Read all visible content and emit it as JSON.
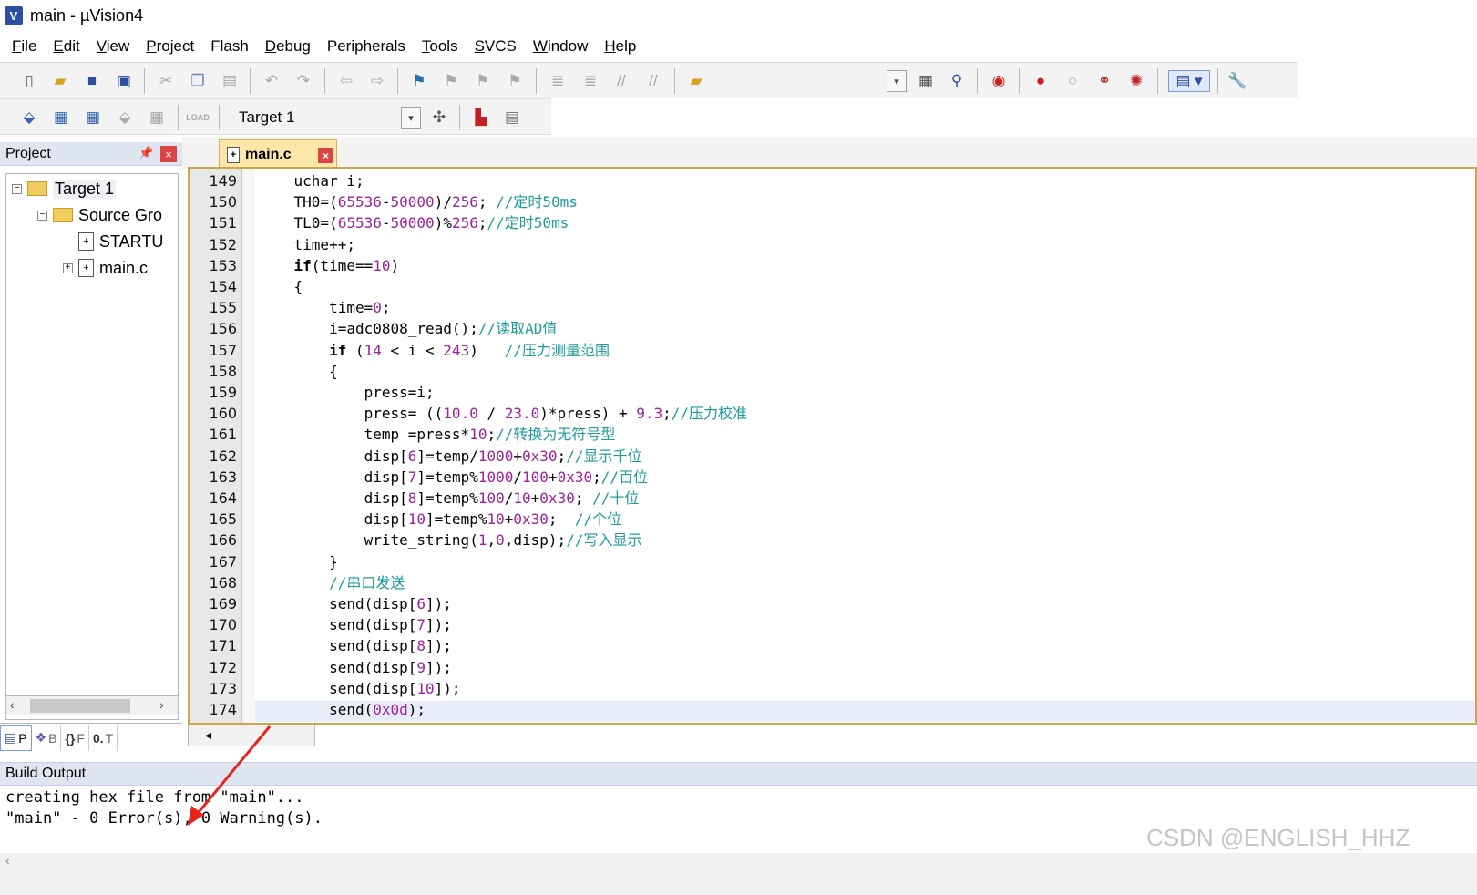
{
  "window": {
    "title": "main  - µVision4",
    "icon_label": "V"
  },
  "menu": [
    {
      "label": "File",
      "u": "F",
      "rest": "ile"
    },
    {
      "label": "Edit",
      "u": "E",
      "rest": "dit"
    },
    {
      "label": "View",
      "u": "V",
      "rest": "iew"
    },
    {
      "label": "Project",
      "u": "P",
      "rest": "roject"
    },
    {
      "label": "Flash",
      "u": "",
      "rest": "Flash"
    },
    {
      "label": "Debug",
      "u": "D",
      "rest": "ebug"
    },
    {
      "label": "Peripherals",
      "u": "",
      "rest": "Peripherals"
    },
    {
      "label": "Tools",
      "u": "T",
      "rest": "ools"
    },
    {
      "label": "SVCS",
      "u": "S",
      "rest": "VCS"
    },
    {
      "label": "Window",
      "u": "W",
      "rest": "indow"
    },
    {
      "label": "Help",
      "u": "H",
      "rest": "elp"
    }
  ],
  "toolbar2": {
    "target": "Target 1",
    "load_label": "LOAD"
  },
  "project": {
    "title": "Project",
    "tree": [
      {
        "label": "Target 1",
        "expander": "−",
        "kind": "target"
      },
      {
        "label": "Source Gro",
        "expander": "−",
        "kind": "folder"
      },
      {
        "label": "STARTU",
        "expander": "",
        "kind": "file"
      },
      {
        "label": "main.c",
        "expander": "+",
        "kind": "file"
      }
    ],
    "tabs": [
      "P",
      "B",
      "F",
      "T"
    ]
  },
  "editor": {
    "tab_label": "main.c",
    "lines": [
      {
        "n": "149",
        "html": "    uchar i;"
      },
      {
        "n": "150",
        "html": "    TH0=(<span class='num'>65536</span>-<span class='num'>50000</span>)/<span class='num'>256</span>; <span class='cm'>//定时50ms</span>"
      },
      {
        "n": "151",
        "html": "    TL0=(<span class='num'>65536</span>-<span class='num'>50000</span>)%<span class='num'>256</span>;<span class='cm'>//定时50ms</span>"
      },
      {
        "n": "152",
        "html": "    time++;"
      },
      {
        "n": "153",
        "html": "    <span class='kw'>if</span>(time==<span class='num'>10</span>)"
      },
      {
        "n": "154",
        "html": "    {"
      },
      {
        "n": "155",
        "html": "        time=<span class='num'>0</span>;"
      },
      {
        "n": "156",
        "html": "        i=adc0808_read();<span class='cm'>//读取AD值</span>"
      },
      {
        "n": "157",
        "html": "        <span class='kw'>if</span> (<span class='num'>14</span> &lt; i &lt; <span class='num'>243</span>)   <span class='cm'>//压力测量范围</span>"
      },
      {
        "n": "158",
        "html": "        {"
      },
      {
        "n": "159",
        "html": "            press=i;"
      },
      {
        "n": "160",
        "html": "            press= ((<span class='num'>10.0</span> / <span class='num'>23.0</span>)*press) + <span class='num'>9.3</span>;<span class='cm'>//压力校准</span>"
      },
      {
        "n": "161",
        "html": "            temp =press*<span class='num'>10</span>;<span class='cm'>//转换为无符号型</span>"
      },
      {
        "n": "162",
        "html": "            disp[<span class='num'>6</span>]=temp/<span class='num'>1000</span>+<span class='num'>0x30</span>;<span class='cm'>//显示千位</span>"
      },
      {
        "n": "163",
        "html": "            disp[<span class='num'>7</span>]=temp%<span class='num'>1000</span>/<span class='num'>100</span>+<span class='num'>0x30</span>;<span class='cm'>//百位</span>"
      },
      {
        "n": "164",
        "html": "            disp[<span class='num'>8</span>]=temp%<span class='num'>100</span>/<span class='num'>10</span>+<span class='num'>0x30</span>; <span class='cm'>//十位</span>"
      },
      {
        "n": "165",
        "html": "            disp[<span class='num'>10</span>]=temp%<span class='num'>10</span>+<span class='num'>0x30</span>;  <span class='cm'>//个位</span>"
      },
      {
        "n": "166",
        "html": "            write_string(<span class='num'>1</span>,<span class='num'>0</span>,disp);<span class='cm'>//写入显示</span>"
      },
      {
        "n": "167",
        "html": "        }"
      },
      {
        "n": "168",
        "html": "        <span class='cm'>//串口发送</span>"
      },
      {
        "n": "169",
        "html": "        send(disp[<span class='num'>6</span>]);"
      },
      {
        "n": "170",
        "html": "        send(disp[<span class='num'>7</span>]);"
      },
      {
        "n": "171",
        "html": "        send(disp[<span class='num'>8</span>]);"
      },
      {
        "n": "172",
        "html": "        send(disp[<span class='num'>9</span>]);"
      },
      {
        "n": "173",
        "html": "        send(disp[<span class='num'>10</span>]);"
      },
      {
        "n": "174",
        "html": "        send(<span class='num'>0x0d</span>);"
      }
    ]
  },
  "build": {
    "title": "Build Output",
    "lines": [
      "creating hex file from \"main\"...",
      "\"main\" - 0 Error(s), 0 Warning(s)."
    ]
  },
  "watermark": "CSDN @ENGLISH_HHZ"
}
